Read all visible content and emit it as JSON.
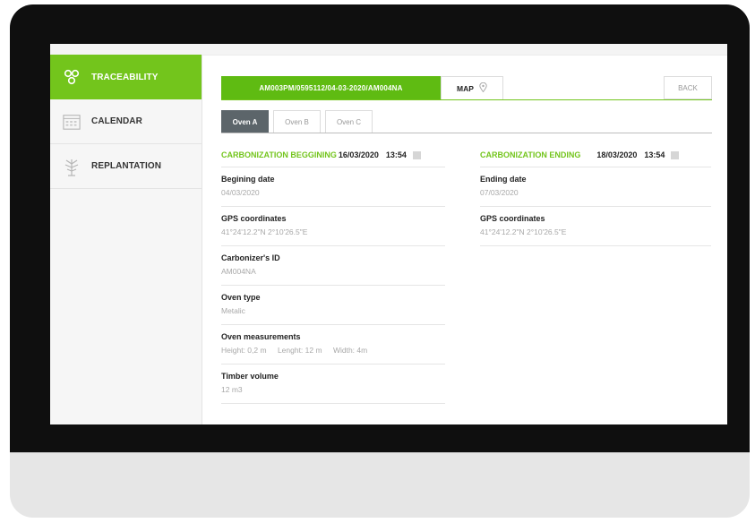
{
  "colors": {
    "accent": "#73c51c",
    "bezel": "#0f0f0f",
    "stand": "#e6e6e6",
    "active_tab": "#5c656a"
  },
  "sidebar": {
    "items": [
      {
        "label": "TRACEABILITY",
        "icon": "traceability-nodes-icon",
        "active": true
      },
      {
        "label": "CALENDAR",
        "icon": "calendar-icon",
        "active": false
      },
      {
        "label": "REPLANTATION",
        "icon": "tree-icon",
        "active": false
      }
    ]
  },
  "header": {
    "id_tab": "AM003PM/0595112/04-03-2020/AM004NA",
    "map_label": "MAP",
    "map_icon": "location-pin-icon",
    "back_label": "BACK"
  },
  "oven_tabs": [
    {
      "label": "Oven A",
      "active": true
    },
    {
      "label": "Oven B",
      "active": false
    },
    {
      "label": "Oven C",
      "active": false
    }
  ],
  "beginning": {
    "title": "CARBONIZATION BEGGINING",
    "date": "16/03/2020",
    "time": "13:54",
    "fields": [
      {
        "label": "Begining date",
        "value": "04/03/2020"
      },
      {
        "label": "GPS coordinates",
        "value": "41°24'12.2\"N 2°10'26.5\"E"
      },
      {
        "label": "Carbonizer's ID",
        "value": "AM004NA"
      },
      {
        "label": "Oven type",
        "value": "Metalic"
      }
    ],
    "measurements": {
      "label": "Oven measurements",
      "height": "Height: 0,2 m",
      "length": "Lenght: 12 m",
      "width": "Width: 4m"
    },
    "timber": {
      "label": "Timber volume",
      "value": "12 m3"
    }
  },
  "ending": {
    "title": "CARBONIZATION ENDING",
    "date": "18/03/2020",
    "time": "13:54",
    "fields": [
      {
        "label": "Ending date",
        "value": "07/03/2020"
      },
      {
        "label": "GPS coordinates",
        "value": "41°24'12.2\"N 2°10'26.5\"E"
      }
    ]
  }
}
